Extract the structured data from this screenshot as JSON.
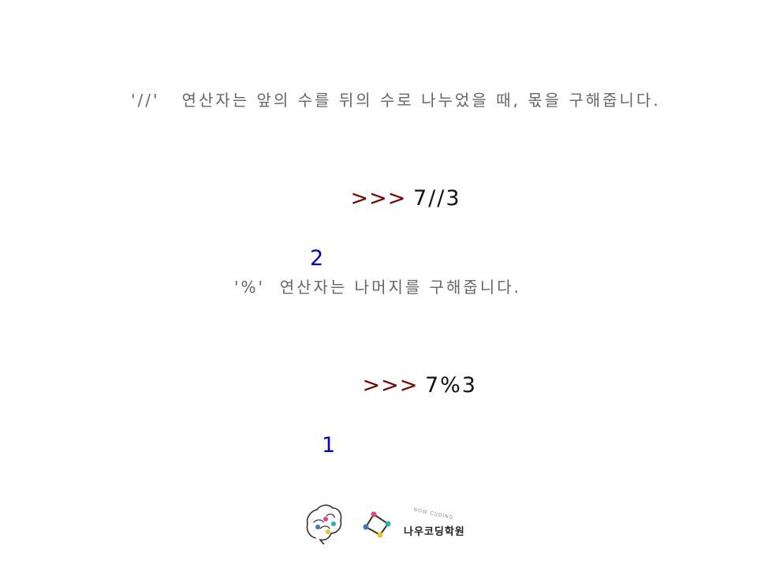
{
  "slide": {
    "floor_division": {
      "description": "'//'   연산자는 앞의 수를 뒤의 수로 나누었을 때, 몫을 구해줍니다.",
      "prompt": ">>>",
      "expression": "7//3",
      "result": "2"
    },
    "modulo": {
      "description": "'%'  연산자는 나머지를 구해줍니다.",
      "prompt": ">>>",
      "expression": "7%3",
      "result": "1"
    }
  },
  "branding": {
    "academy_name": "나우코딩학원",
    "academy_sub": "NOW CODING",
    "icons": [
      "brain-logo-icon",
      "network-logo-icon"
    ]
  },
  "colors": {
    "caption": "#666666",
    "prompt": "#7a0000",
    "expression": "#111111",
    "result": "#0000cc"
  }
}
